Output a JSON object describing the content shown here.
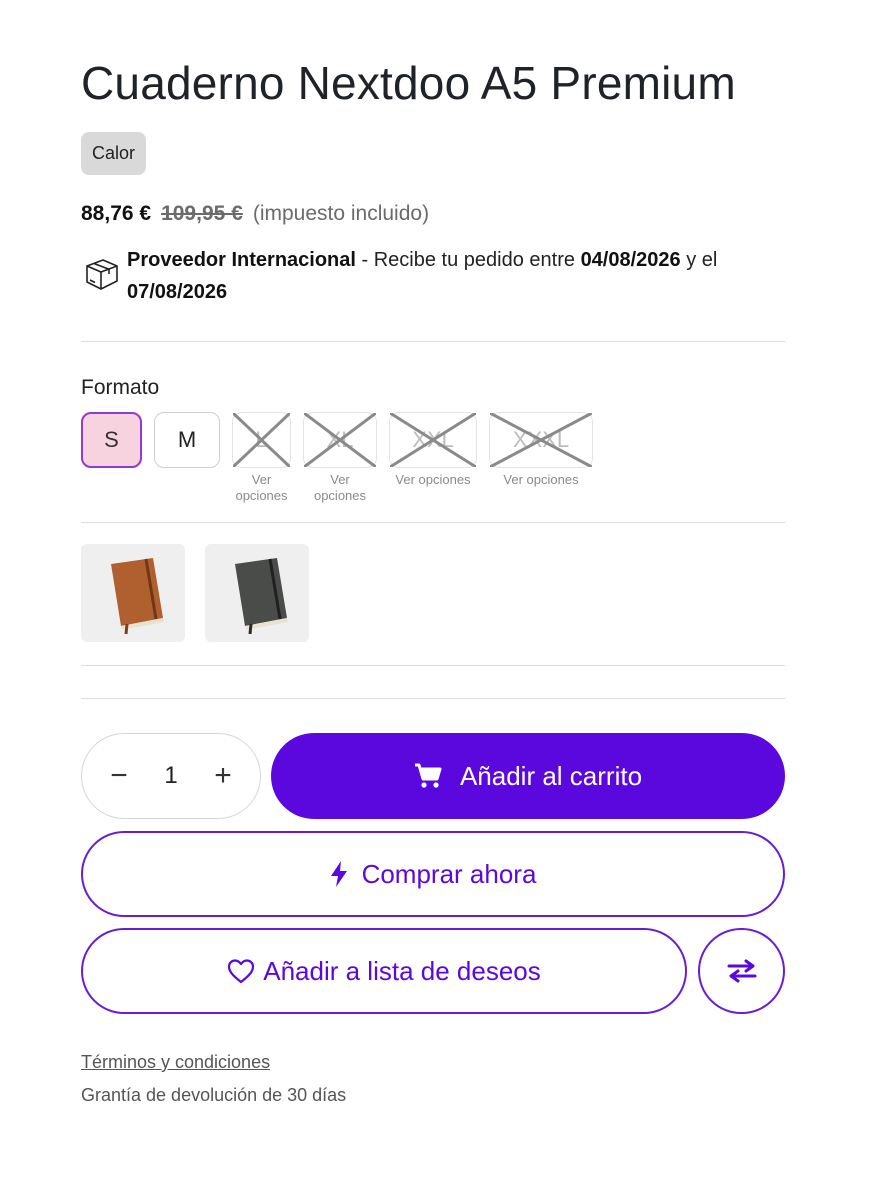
{
  "product": {
    "title": "Cuaderno Nextdoo A5 Premium",
    "badge": "Calor",
    "price_current": "88,76 €",
    "price_old": "109,95 €",
    "price_note": "(impuesto incluido)"
  },
  "shipping": {
    "icon": "package-box-icon",
    "provider": "Proveedor Internacional",
    "text_pre": " - Recibe tu pedido entre ",
    "date_from": "04/08/2026",
    "text_mid": " y el ",
    "date_to": "07/08/2026"
  },
  "format": {
    "label": "Formato",
    "options": [
      {
        "label": "S",
        "state": "selected",
        "sub": ""
      },
      {
        "label": "M",
        "state": "available",
        "sub": ""
      },
      {
        "label": "L",
        "state": "unavailable",
        "sub": "Ver opciones"
      },
      {
        "label": "XL",
        "state": "unavailable",
        "sub": "Ver opciones"
      },
      {
        "label": "XXL",
        "state": "unavailable",
        "sub": "Ver opciones"
      },
      {
        "label": "XXXL",
        "state": "unavailable",
        "sub": "Ver opciones"
      }
    ]
  },
  "thumbnails": [
    {
      "name": "notebook-brown",
      "color": "#b05f2e"
    },
    {
      "name": "notebook-black",
      "color": "#4a4c4a"
    }
  ],
  "quantity": {
    "value": "1",
    "minus": "−",
    "plus": "+"
  },
  "actions": {
    "add_to_cart": "Añadir al carrito",
    "buy_now": "Comprar ahora",
    "wishlist": "Añadir a lista de deseos"
  },
  "footer": {
    "terms": "Términos y condiciones",
    "guarantee": "Grantía de devolución de 30 días"
  },
  "colors": {
    "accent": "#5b08df",
    "selected_bg": "#f6d3de",
    "selected_border": "#8e3ccf"
  }
}
